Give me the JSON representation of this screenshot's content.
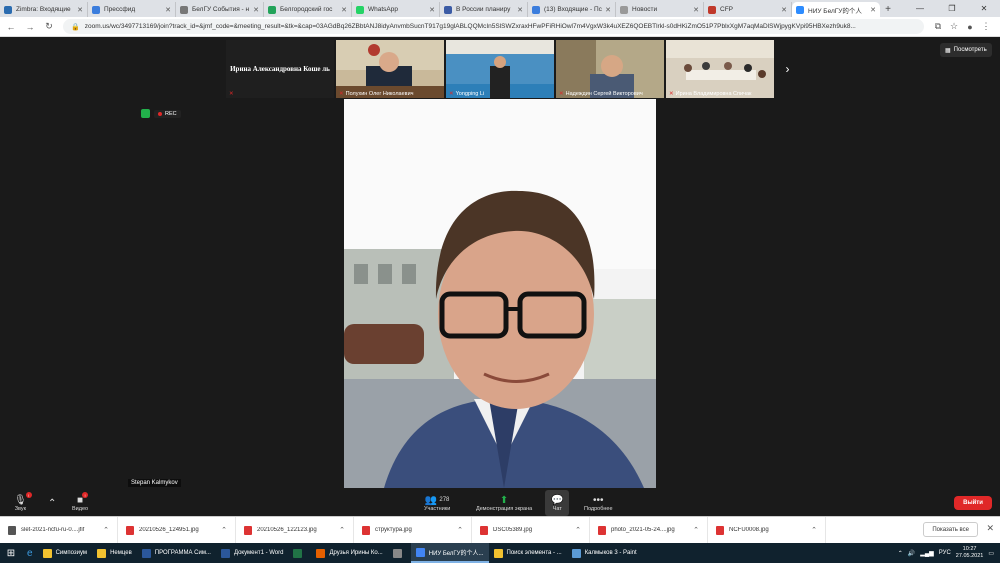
{
  "browser": {
    "tabs": [
      {
        "title": "Zimbra: Входящие",
        "color": "#2b6cb0"
      },
      {
        "title": "Прессфид",
        "color": "#3b7ddd"
      },
      {
        "title": "БелГУ События - н",
        "color": "#777777"
      },
      {
        "title": "Белгородский гос",
        "color": "#22a35a"
      },
      {
        "title": "WhatsApp",
        "color": "#25d366"
      },
      {
        "title": "В России планиру",
        "color": "#3b5ba5"
      },
      {
        "title": "(13) Входящие - Пс",
        "color": "#3b7ddd"
      },
      {
        "title": "Новости",
        "color": "#999999"
      },
      {
        "title": "CFP",
        "color": "#c0392b"
      },
      {
        "title": "НИУ БелГУ的个人",
        "color": "#2d8cff"
      }
    ],
    "url": "zoom.us/wc/3497713169/join?track_id=&jmf_code=&meeting_result=&tk=&cap=03AGdBq26ZBbtANJ8idyAnvmbSucnT917g19glABLQQMcIn5SlSWZxraxHFwPFiRHiOwl7m4VgxW3k4uXEZ6QOEBTlrkl-s0dHKiZmO51P7PblxXgM7aqMaDlSWjpygKVpi95HBXezh9uk8..."
  },
  "zoom": {
    "thumbnails": [
      {
        "name": "Ирина Александровна Коше ль",
        "kind": "text"
      },
      {
        "name": "Полухин Олег Николаевич",
        "kind": "video"
      },
      {
        "name": "Yongping Li",
        "kind": "video"
      },
      {
        "name": "Надеждин Сергей Викторович",
        "kind": "video"
      },
      {
        "name": "Ирина Владимировна Спичак",
        "kind": "video"
      }
    ],
    "view_label": "Посмотреть",
    "rec_label": "REC",
    "speaker_name": "Stepan Kalmykov",
    "controls": {
      "audio": "Звук",
      "video": "Видео",
      "participants": "Участники",
      "participants_count": "278",
      "share": "Демонстрация экрана",
      "chat": "Чат",
      "more": "Подробнее",
      "exit": "Выйти"
    }
  },
  "downloads": {
    "items": [
      "slet-2021-ncfu-ru-0....jfif",
      "20210526_124951.jpg",
      "20210526_122123.jpg",
      "структура.jpg",
      "DSC05389.jpg",
      "photo_2021-05-24....jpg",
      "NCFU0008.jpg"
    ],
    "show_all": "Показать все"
  },
  "taskbar": {
    "apps": [
      {
        "label": "Симпозиум",
        "color": "#f2c230"
      },
      {
        "label": "Немцев",
        "color": "#f2c230"
      },
      {
        "label": "ПРОГРАММА Сим...",
        "color": "#2b579a"
      },
      {
        "label": "Документ1 - Word",
        "color": "#2b579a"
      },
      {
        "label": "",
        "color": "#217346"
      },
      {
        "label": "Друзья Ирины Ко...",
        "color": "#e66000"
      },
      {
        "label": "",
        "color": "#888888"
      },
      {
        "label": "НИУ БелГУ的个人...",
        "color": "#4285f4"
      },
      {
        "label": "Поиск элемента - ...",
        "color": "#f2c230"
      },
      {
        "label": "Калмыков 3 - Paint",
        "color": "#5b9bd5"
      }
    ],
    "lang": "РУС",
    "time": "10:27",
    "date": "27.05.2021"
  }
}
